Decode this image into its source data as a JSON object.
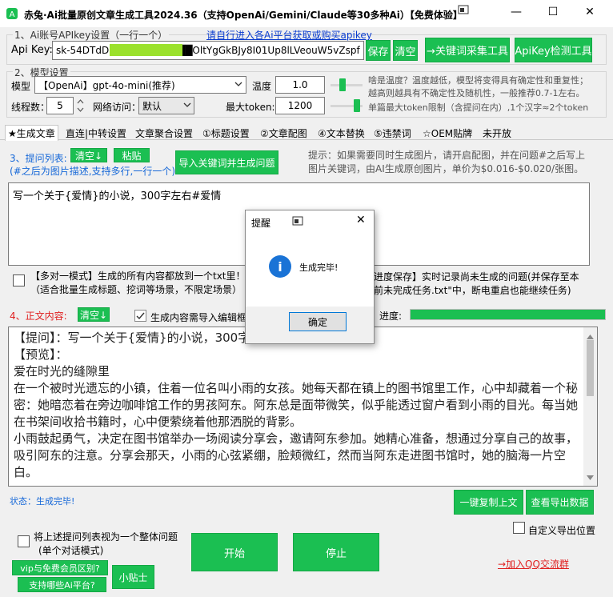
{
  "window": {
    "title": "赤兔·Ai批量原创文章生成工具2024.36（支持OpenAi/Gemini/Claude等30多种Ai）【免费体验】",
    "minimize": "—",
    "maximize": "☐",
    "close": "✕"
  },
  "section1": {
    "label": "1、Ai账号APIkey设置（一行一个）",
    "link": "请自行进入各Ai平台获取或购买apikey",
    "apikey_label": "Api Key:",
    "apikey_value": "sk-54DTdDCJ██████████OltYgGkBJy8I01Up8lLVeouW5vZspf",
    "save": "保存",
    "clear": "清空",
    "collect_tool": "→关键词采集工具",
    "check_tool": "ApiKey检测工具"
  },
  "section2": {
    "label": "2、模型设置",
    "model_label": "模型",
    "model_value": "【OpenAi】gpt-4o-mini(推荐)",
    "temp_label": "温度",
    "temp_value": "1.0",
    "temp_note1": "啥是温度？温度越低，模型将变得具有确定性和重复性；",
    "temp_note2": "越高则越具有不确定性及随机性，一般推荐0.7-1左右。",
    "threads_label": "线程数：",
    "threads_value": "5",
    "network_label": "网络访问：",
    "network_value": "默认",
    "maxtoken_label": "最大token:",
    "maxtoken_value": "1200",
    "token_note": "单篇最大token限制（含提问在内）,1个汉字≈2个token",
    "temp_slider_level": 0.35,
    "token_slider_level": 0.9
  },
  "tabs": [
    "★生成文章",
    "直连|中转设置",
    "文章聚合设置",
    "①标题设置",
    "②文章配图",
    "④文本替换",
    "⑤违禁词",
    "☆OEM贴牌",
    "未开放"
  ],
  "section3": {
    "label": "3、提问列表:",
    "clear": "清空↓",
    "paste": "粘贴",
    "sublabel": "(#之后为图片描述,支持多行,一行一个)",
    "import_btn": "导入关键词并生成问题",
    "hint": "提示：如果需要同时生成图片，请开启配图，并在问题#之后写上图片关键词，由AI生成原创图片，单价为$0.016-$0.020/张图。",
    "question": "写一个关于{爱情}的小说，300字左右#爱情",
    "multi_q_line1": "【多对一模式】生成的所有内容都放到一个txt里！",
    "multi_q_line2": "（适合批量生成标题、挖词等场景，不限定场景）",
    "progress_line1": "进度保存】实时记录尚未生成的问题(并保存至本",
    "progress_line2": "前未完成任务.txt\"中，断电重启也能继续任务)"
  },
  "section4": {
    "label": "4、正文内容:",
    "clear": "清空↓",
    "import_editor": "生成内容需导入编辑框(",
    "progress_label": "进度:",
    "progress_value": 1.0,
    "content": "【提问】：写一个关于{爱情}的小说，300字左右\n【预览】：\n爱在时光的缝隙里\n在一个被时光遗忘的小镇，住着一位名叫小雨的女孩。她每天都在镇上的图书馆里工作，心中却藏着一个秘密：她暗恋着在旁边咖啡馆工作的男孩阿东。阿东总是面带微笑，似乎能透过窗户看到小雨的目光。每当她在书架间收拾书籍时，心中便萦绕着他那洒脱的背影。\n小雨鼓起勇气，决定在图书馆举办一场阅读分享会，邀请阿东参加。她精心准备，想通过分享自己的故事，吸引阿东的注意。分享会那天，小雨的心弦紧绷，脸颊微红，然而当阿东走进图书馆时，她的脑海一片空白。"
  },
  "status": {
    "text": "状态：生成完毕!",
    "copy_btn": "一键复制上文",
    "export_btn": "查看导出数据",
    "custom_export": "自定义导出位置"
  },
  "bottom": {
    "whole_line1": "将上述提问列表视为一个整体问题",
    "whole_line2": "(单个对话模式)",
    "start": "开始",
    "stop": "停止",
    "qq_link": "→加入QQ交流群",
    "vip_btn": "vip与免费会员区别?",
    "platforms_btn": "支持哪些Ai平台?",
    "tips_btn": "小贴士"
  },
  "dialog": {
    "title": "提醒",
    "close": "✕",
    "message": "生成完毕!",
    "ok": "确定",
    "info_icon_glyph": "i"
  },
  "colors": {
    "accent_green": "#1bbf52",
    "link_blue": "#0a3ccf",
    "section_blue": "#1668d8",
    "section_red": "#e02020"
  }
}
